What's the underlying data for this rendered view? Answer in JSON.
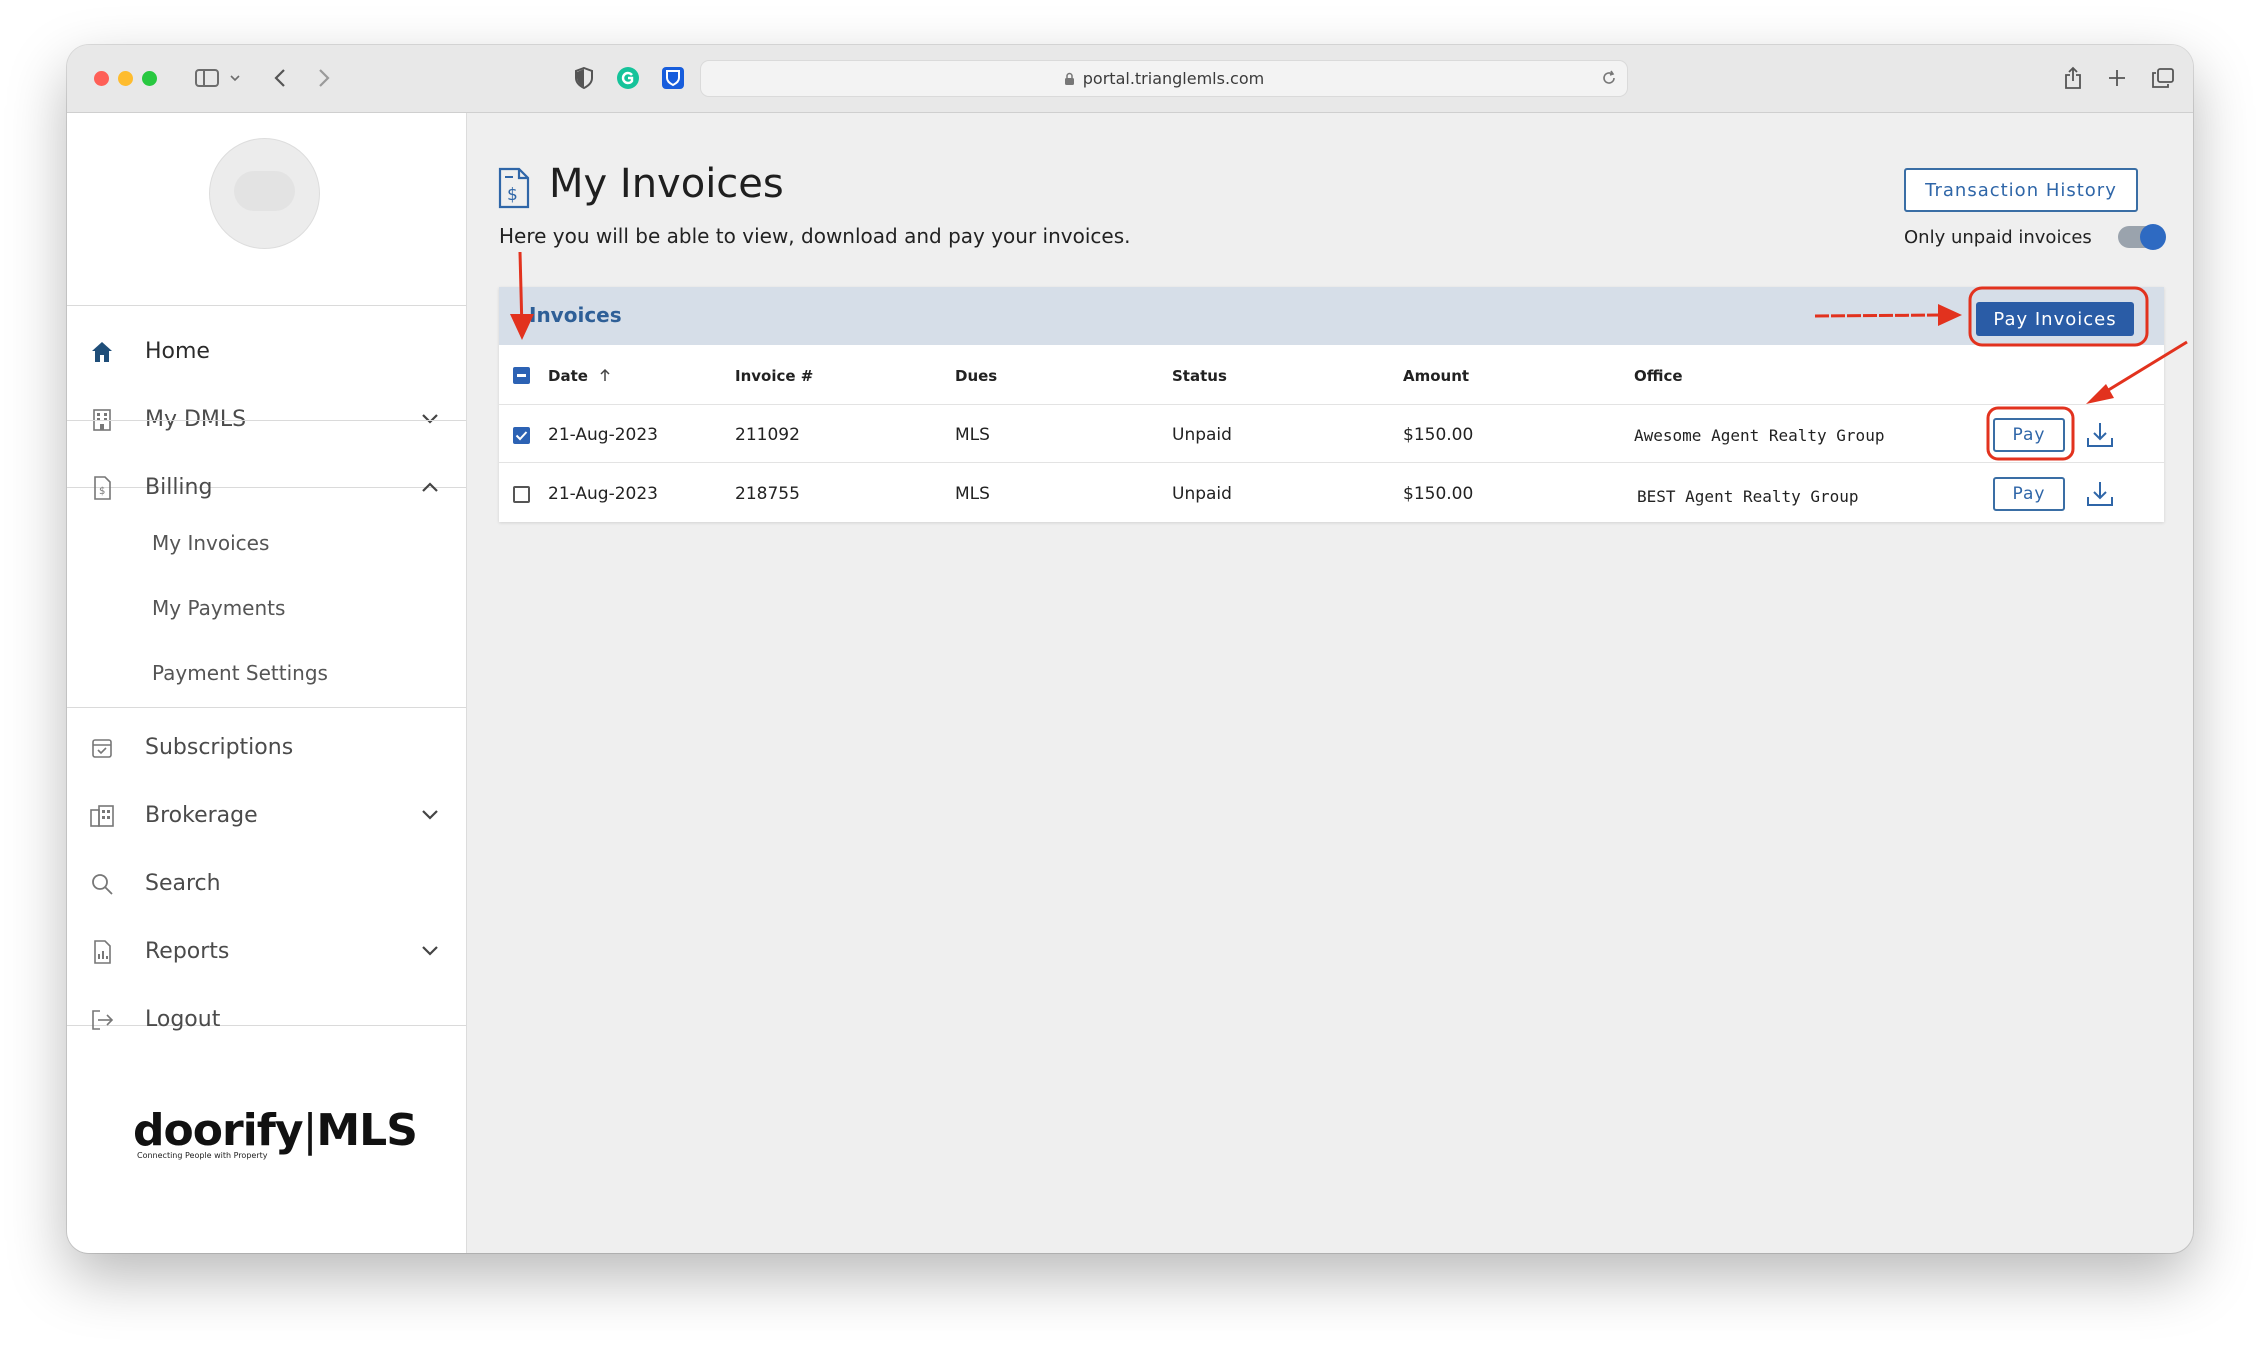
{
  "browser": {
    "url": "portal.trianglemls.com"
  },
  "sidebar": {
    "nav": [
      {
        "label": "Home",
        "icon": "home-icon"
      },
      {
        "label": "My DMLS",
        "icon": "building-icon"
      },
      {
        "label": "Billing",
        "icon": "invoice-icon"
      },
      {
        "label": "Subscriptions",
        "icon": "calendar-icon"
      },
      {
        "label": "Brokerage",
        "icon": "brokerage-icon"
      },
      {
        "label": "Search",
        "icon": "search-icon"
      },
      {
        "label": "Reports",
        "icon": "report-icon"
      },
      {
        "label": "Logout",
        "icon": "logout-icon"
      }
    ],
    "billing_sub": [
      "My Invoices",
      "My Payments",
      "Payment Settings"
    ],
    "brand": {
      "name_left": "doorify",
      "name_right": "MLS",
      "tagline": "Connecting People with Property"
    }
  },
  "main": {
    "title": "My Invoices",
    "subtitle": "Here you will be able to view, download and pay your invoices.",
    "transaction_history": "Transaction History",
    "toggle_label": "Only unpaid invoices",
    "toggle_on": true,
    "card_title": "Invoices",
    "pay_invoices": "Pay Invoices",
    "columns": [
      "Date",
      "Invoice #",
      "Dues",
      "Status",
      "Amount",
      "Office"
    ],
    "rows": [
      {
        "checked": true,
        "date": "21-Aug-2023",
        "invoice": "211092",
        "dues": "MLS",
        "status": "Unpaid",
        "amount": "$150.00",
        "office": "Awesome Agent Realty Group",
        "pay": "Pay"
      },
      {
        "checked": false,
        "date": "21-Aug-2023",
        "invoice": "218755",
        "dues": "MLS",
        "status": "Unpaid",
        "amount": "$150.00",
        "office": "BEST Agent Realty Group",
        "pay": "Pay"
      }
    ]
  },
  "colors": {
    "accent": "#2a5ca6",
    "annotation": "#e2321e",
    "header_band": "#d6dee8"
  }
}
